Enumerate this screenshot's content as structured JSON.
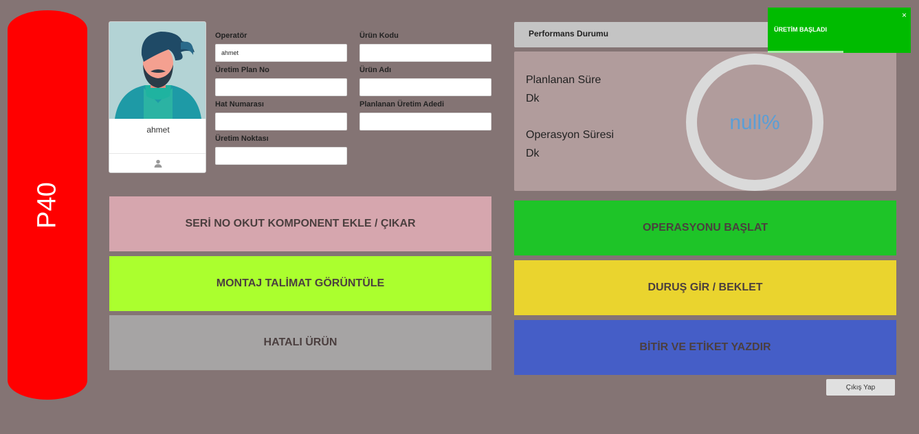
{
  "station": {
    "label": "P40",
    "color": "#ff0000"
  },
  "operator": {
    "name": "ahmet",
    "icon": "user-icon"
  },
  "form": {
    "left": [
      {
        "label": "Operatör",
        "value": "ahmet"
      },
      {
        "label": "Üretim Plan No",
        "value": ""
      },
      {
        "label": "Hat Numarası",
        "value": ""
      },
      {
        "label": "Üretim Noktası",
        "value": ""
      }
    ],
    "right": [
      {
        "label": "Ürün Kodu",
        "value": ""
      },
      {
        "label": "Ürün Adı",
        "value": ""
      },
      {
        "label": "Planlanan Üretim Adedi",
        "value": ""
      }
    ]
  },
  "actions_left": [
    {
      "label": "SERİ NO OKUT KOMPONENT EKLE / ÇIKAR",
      "color": "#d6a6ae"
    },
    {
      "label": "MONTAJ TALİMAT GÖRÜNTÜLE",
      "color": "#abff2e"
    },
    {
      "label": "HATALI ÜRÜN",
      "color": "#a6a4a4"
    }
  ],
  "actions_right": [
    {
      "label": "OPERASYONU BAŞLAT",
      "color": "#1ec428"
    },
    {
      "label": "DURUŞ GİR / BEKLET",
      "color": "#ead42e"
    },
    {
      "label": "BİTİR VE ETİKET YAZDIR",
      "color": "#455ec7"
    }
  ],
  "performance": {
    "title": "Performans Durumu",
    "planned_label": "Planlanan Süre",
    "planned_unit": "Dk",
    "operation_label": "Operasyon Süresi",
    "operation_unit": "Dk",
    "percent_text": "null%"
  },
  "toast": {
    "message": "ÜRETİM BAŞLADI",
    "close": "×",
    "color": "#00bb00",
    "progress": 0.53
  },
  "logout_label": "Çıkış Yap"
}
